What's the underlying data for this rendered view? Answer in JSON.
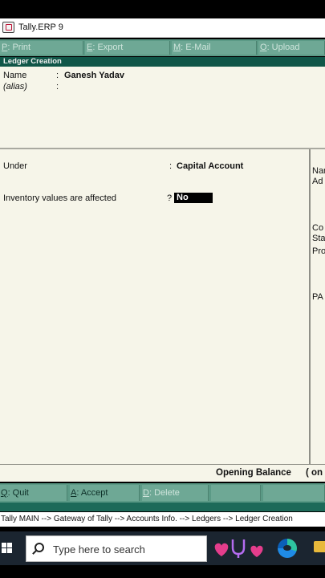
{
  "window": {
    "title": "Tally.ERP 9"
  },
  "top_buttons": [
    {
      "key": "P",
      "label": ": Print"
    },
    {
      "key": "E",
      "label": ": Export"
    },
    {
      "key": "M",
      "label": ": E-Mail"
    },
    {
      "key": "O",
      "label": ": Upload"
    }
  ],
  "form": {
    "header": "Ledger Creation",
    "name_label": "Name",
    "name_colon": ":",
    "name_value": "Ganesh Yadav",
    "alias_label": "(alias)",
    "alias_colon": ":",
    "under_label": "Under",
    "under_colon": ":",
    "under_value": "Capital Account",
    "inventory_label": "Inventory values are affected",
    "inventory_prompt": "?",
    "inventory_value": "No"
  },
  "right_panel": {
    "lines": [
      "Nar",
      "Ad",
      "Co",
      "Sta",
      "Pro",
      "PA"
    ]
  },
  "opening_balance": {
    "label": "Opening Balance",
    "suffix": "( on"
  },
  "bottom_buttons": [
    {
      "key": "Q",
      "label": ": Quit"
    },
    {
      "key": "A",
      "label": ": Accept"
    },
    {
      "key": "D",
      "label": ": Delete"
    }
  ],
  "breadcrumb": "Tally MAIN --> Gateway of Tally --> Accounts Info. --> Ledgers --> Ledger Creation",
  "taskbar": {
    "search_placeholder": "Type here to search"
  }
}
